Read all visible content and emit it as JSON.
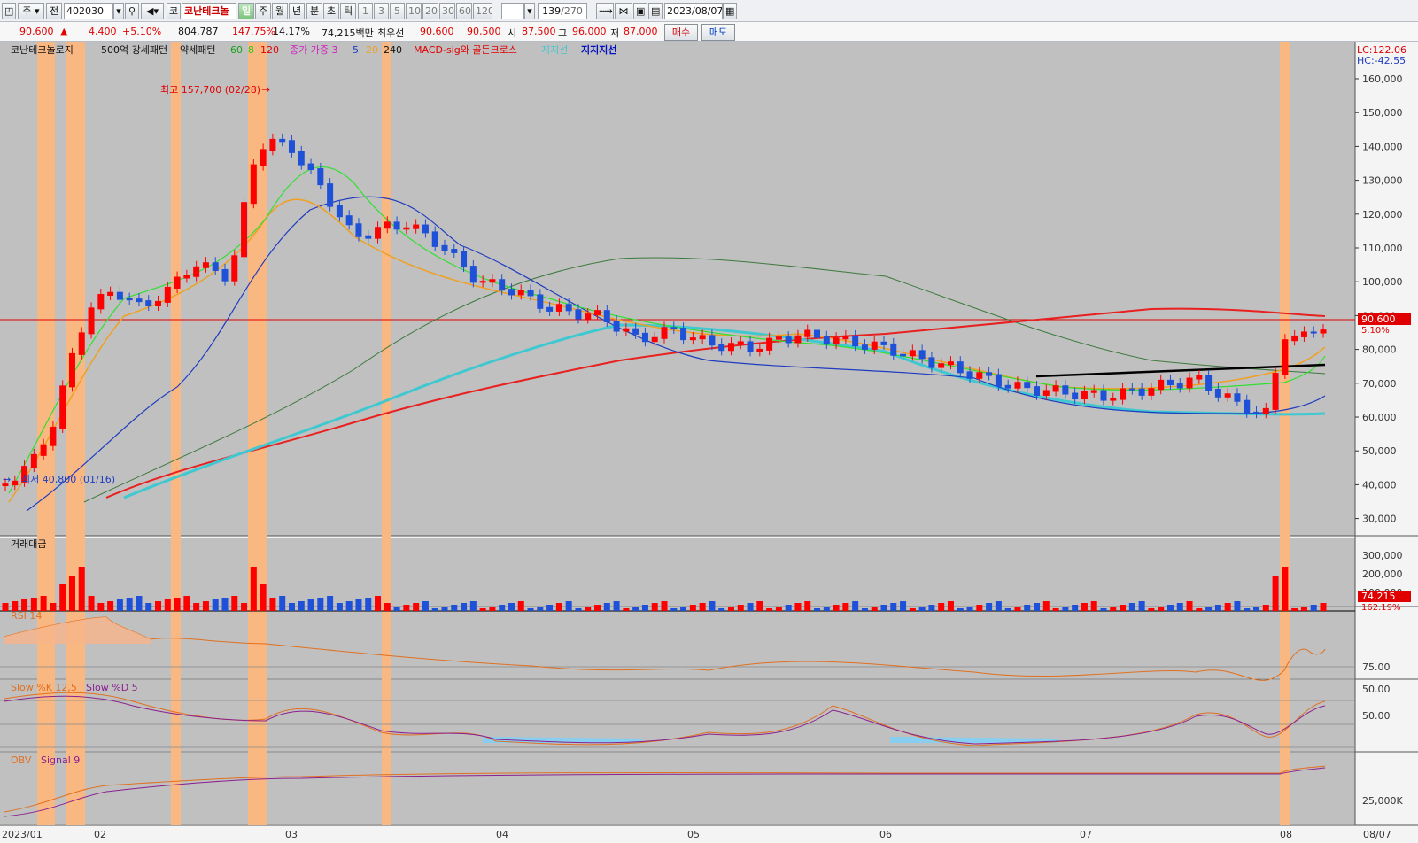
{
  "toolbar": {
    "mode_1": "주",
    "mode_2": "전",
    "code": "402030",
    "market_tag": "코",
    "stock_name": "코난테크놀",
    "periods": [
      "일",
      "주",
      "월",
      "년",
      "분",
      "초",
      "틱"
    ],
    "active_period": "일",
    "intervals": [
      "1",
      "3",
      "5",
      "10",
      "20",
      "30",
      "60",
      "120"
    ],
    "count": "139",
    "count_total": "/270",
    "date": "2023/08/07"
  },
  "quote": {
    "price": "90,600",
    "arrow": "▲",
    "change": "4,400",
    "change_pct": "+5.10%",
    "volume": "804,787",
    "volume_ratio": "147.75%",
    "turnover": "14.17%",
    "amount": "74,215백만",
    "best_ask_label": "최우선",
    "best_ask": "90,600",
    "best_bid": "90,500",
    "open_label": "시",
    "open": "87,500",
    "high_label": "고",
    "high": "96,000",
    "low_label": "저",
    "low": "87,000",
    "buy_label": "매수",
    "sell_label": "매도"
  },
  "legend": {
    "stock": "코난테크놀로지",
    "ind1": "500억 강세패턴",
    "ind2": "약세패턴",
    "ma60": "60",
    "ma8": "8",
    "ma120": "120",
    "close_weighted": "종가 가중 3",
    "ma5": "5",
    "ma20": "20",
    "ma240": "240",
    "macd": "MACD-sig와 골든크로스",
    "support1": "지지선",
    "support2": "지지지선",
    "lc": "LC:122.06",
    "hc": "HC:-42.55"
  },
  "annotations": {
    "max": "최고 157,700 (02/28)",
    "min": "최저 40,800 (01/16)",
    "price_tag": "90,600",
    "price_pct": "5.10%",
    "vol_tag": "74,215",
    "vol_pct": "162.19%"
  },
  "y_ticks": [
    "160,000",
    "150,000",
    "140,000",
    "130,000",
    "120,000",
    "110,000",
    "100,000",
    "90,000",
    "80,000",
    "70,000",
    "60,000",
    "50,000",
    "40,000",
    "30,000"
  ],
  "panels": {
    "volume": {
      "title": "거래대금",
      "ticks": [
        "300,000",
        "200,000",
        "100,000"
      ]
    },
    "rsi": {
      "title": "RSI 14",
      "ticks": [
        "75.00",
        "50.00"
      ]
    },
    "stoch": {
      "title": "Slow %K 12,5",
      "title2": "Slow %D 5",
      "ticks": [
        "50.00"
      ]
    },
    "obv": {
      "title": "OBV",
      "title2": "Signal 9",
      "ticks": [
        "25,000K"
      ]
    }
  },
  "x_ticks": [
    "2023/01",
    "02",
    "03",
    "04",
    "05",
    "06",
    "07",
    "08",
    "08/07"
  ],
  "colors": {
    "up": "#ff0000",
    "down": "#1e50d8",
    "bg": "#c0c0c0",
    "highlight": "#f9b781"
  },
  "chart_data": {
    "type": "candlestick",
    "title": "코난테크놀로지",
    "x": [
      "2023/01/16",
      "2023/02/28",
      "2023/08/07"
    ],
    "close_last": 90600,
    "high_max": 157700,
    "low_min": 40800,
    "ylim": [
      30000,
      160000
    ],
    "series": [
      {
        "name": "종가 가중 3"
      },
      {
        "name": "5"
      },
      {
        "name": "8"
      },
      {
        "name": "20"
      },
      {
        "name": "60"
      },
      {
        "name": "120"
      },
      {
        "name": "240"
      }
    ]
  }
}
